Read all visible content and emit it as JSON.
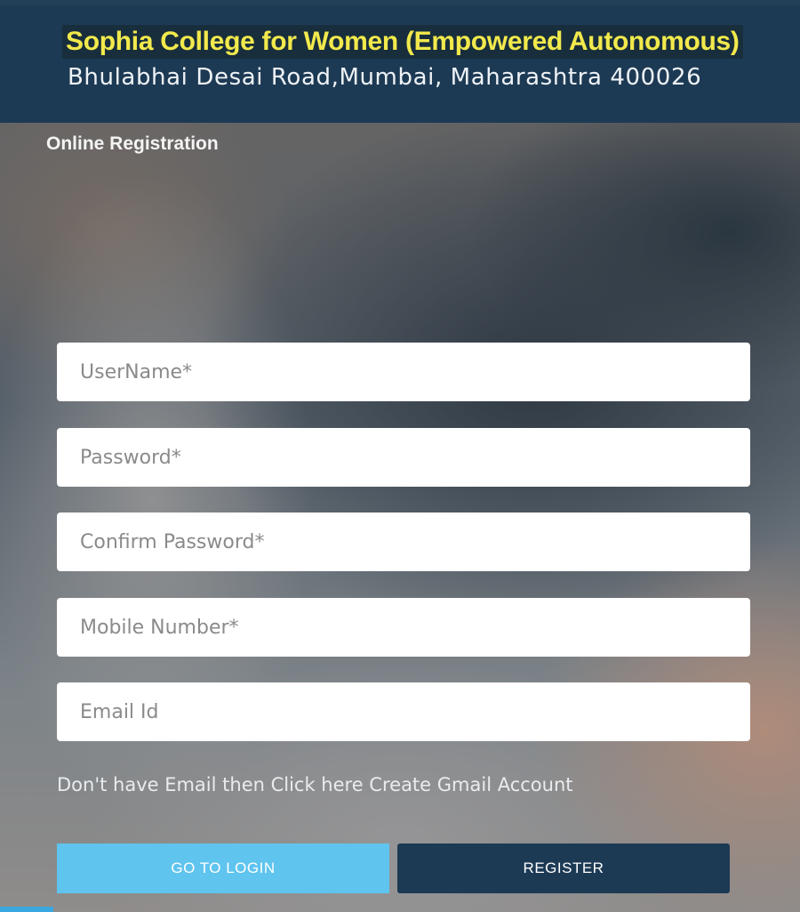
{
  "header": {
    "college_name": "Sophia College for Women (Empowered Autonomous)",
    "college_address": "Bhulabhai Desai Road,Mumbai, Maharashtra 400026"
  },
  "form": {
    "title": "Online Registration",
    "username_placeholder": "UserName*",
    "password_placeholder": "Password*",
    "confirm_password_placeholder": "Confirm Password*",
    "mobile_placeholder": "Mobile Number*",
    "email_placeholder": "Email Id",
    "gmail_note": "Don't have Email then Click here Create Gmail Account",
    "login_button": "GO TO LOGIN",
    "register_button": "REGISTER"
  },
  "colors": {
    "header_bg": "#1d3a55",
    "college_name": "#f2e94c",
    "login_button": "#5fc4ee",
    "register_button": "#1d3a55"
  }
}
